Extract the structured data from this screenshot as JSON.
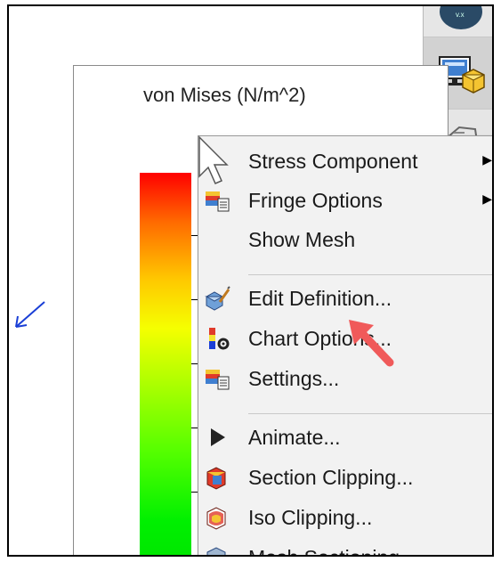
{
  "legend": {
    "title": "von Mises (N/m^2)"
  },
  "menu": {
    "items": [
      {
        "label": "Stress Component",
        "has_submenu": true,
        "icon": "none"
      },
      {
        "label": "Fringe Options",
        "has_submenu": true,
        "icon": "fringe-options-icon"
      },
      {
        "label": "Show Mesh",
        "has_submenu": false,
        "icon": "none"
      },
      {
        "label": "Edit Definition...",
        "has_submenu": false,
        "icon": "edit-definition-icon"
      },
      {
        "label": "Chart Options...",
        "has_submenu": false,
        "icon": "chart-options-icon"
      },
      {
        "label": "Settings...",
        "has_submenu": false,
        "icon": "settings-icon"
      },
      {
        "label": "Animate...",
        "has_submenu": false,
        "icon": "play-icon"
      },
      {
        "label": "Section Clipping...",
        "has_submenu": false,
        "icon": "section-clipping-icon"
      },
      {
        "label": "Iso Clipping...",
        "has_submenu": false,
        "icon": "iso-clipping-icon"
      },
      {
        "label": "Mesh Sectioning...",
        "has_submenu": false,
        "icon": "mesh-sectioning-icon"
      }
    ],
    "submenu_glyph": "▶"
  },
  "colors": {
    "highlight_arrow": "#f05a5a",
    "force_arrow": "#1a3fd6",
    "menu_bg": "#f2f2f2"
  }
}
